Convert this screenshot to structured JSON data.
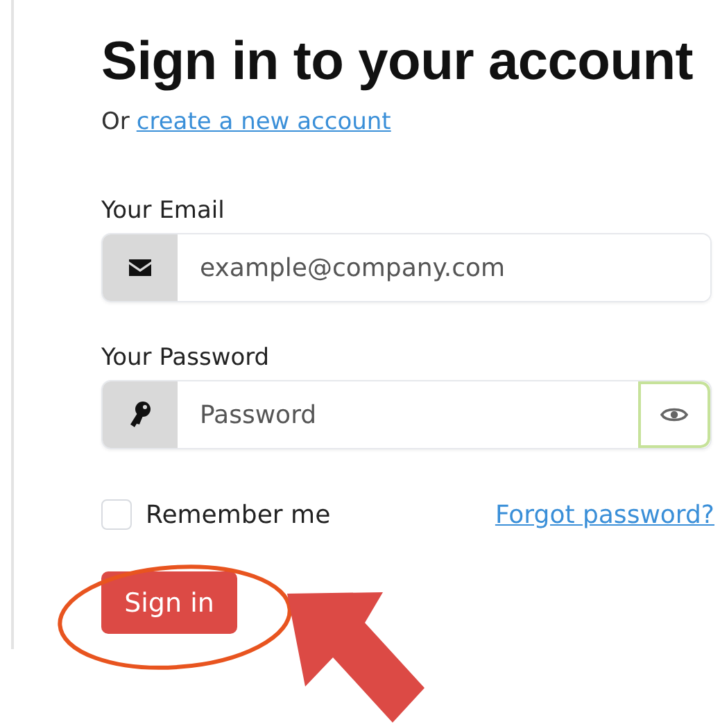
{
  "title": "Sign in to your account",
  "subtitle": {
    "prefix": "Or",
    "link": "create a new account"
  },
  "fields": [
    {
      "kind": "email",
      "label": "Your Email",
      "placeholder": "example@company.com"
    },
    {
      "kind": "password",
      "label": "Your Password",
      "placeholder": "Password"
    }
  ],
  "remember": {
    "label": "Remember me",
    "checked": false
  },
  "forgot_link": "Forgot password?",
  "submit": "Sign in"
}
